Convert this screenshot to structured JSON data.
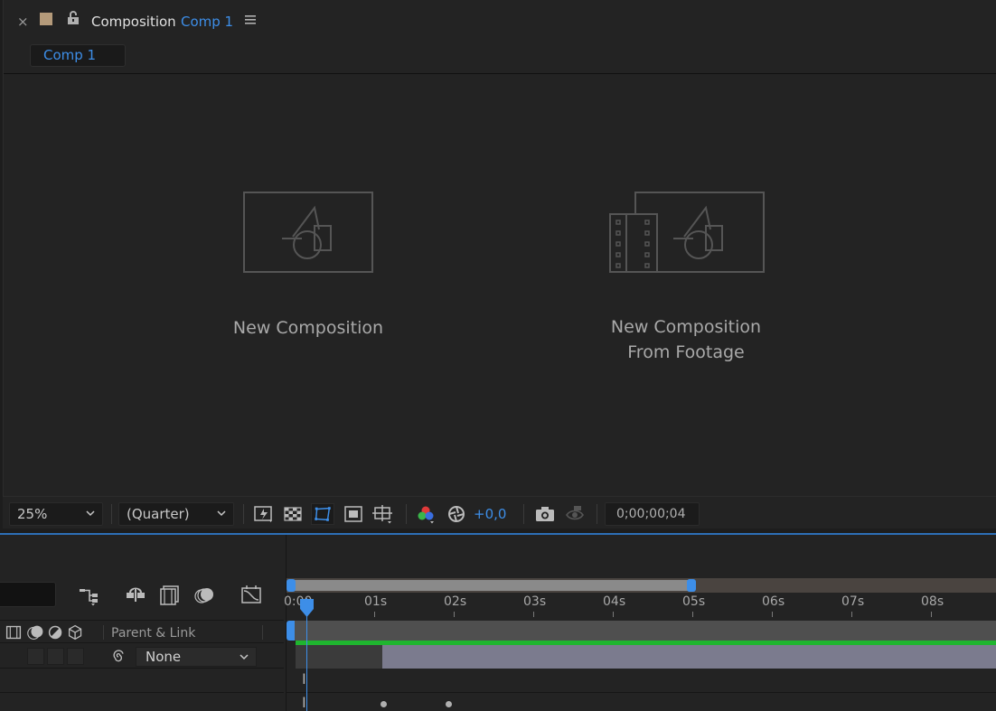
{
  "header": {
    "close": "×",
    "title": "Composition",
    "comp_name": "Comp 1",
    "tab_label": "Comp 1"
  },
  "viewer": {
    "new_composition": "New Composition",
    "new_composition_from_footage_line1": "New Composition",
    "new_composition_from_footage_line2": "From Footage"
  },
  "toolbar": {
    "zoom": "25%",
    "resolution": "(Quarter)",
    "exposure": "+0,0",
    "timecode": "0;00;00;04"
  },
  "timeline": {
    "parent_link_label": "Parent & Link",
    "parent_value": "None",
    "ruler": [
      "0:00",
      "01s",
      "02s",
      "03s",
      "04s",
      "05s",
      "06s",
      "07s",
      "08s"
    ]
  },
  "colors": {
    "accent": "#3d8ee8",
    "label_swatch": "#b49a7a",
    "track_green": "#1fb52f",
    "layer_bar": "#7b7b8e"
  }
}
